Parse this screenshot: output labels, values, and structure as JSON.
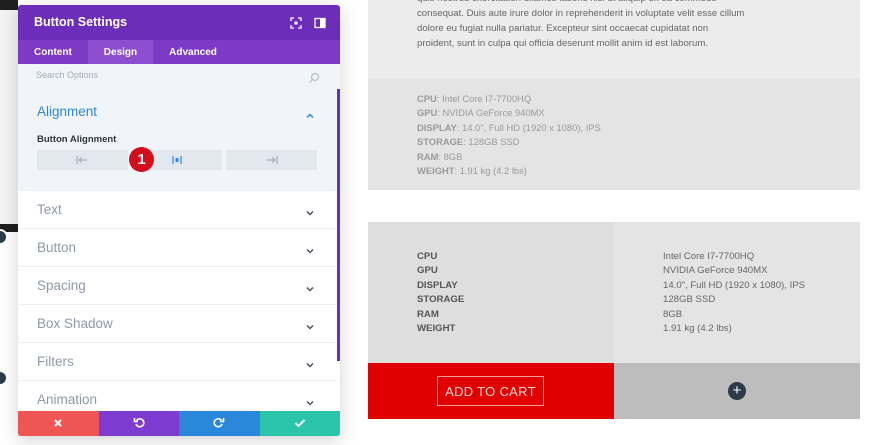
{
  "background_page": {
    "lorem_text": "quis nostrud exercitation ullamco laboris nisi ut aliquip ex ea commodo consequat. Duis aute irure dolor in reprehenderit in voluptate velit esse cillum dolore eu fugiat nulla pariatur. Excepteur sint occaecat cupidatat non proident, sunt in culpa qui officia deserunt mollit anim id est laborum.",
    "spec_list": [
      {
        "label": "CPU",
        "value": ": Intel Core I7-7700HQ"
      },
      {
        "label": "GPU",
        "value": ": NVIDIA GeForce 940MX"
      },
      {
        "label": "DISPLAY",
        "value": ": 14.0\", Full HD (1920 x 1080), IPS"
      },
      {
        "label": "STORAGE",
        "value": ": 128GB SSD"
      },
      {
        "label": "RAM",
        "value": ": 8GB"
      },
      {
        "label": "WEIGHT",
        "value": ": 1.91 kg (4.2 lbs)"
      }
    ],
    "spec_table": {
      "labels": [
        "CPU",
        "GPU",
        "DISPLAY",
        "STORAGE",
        "RAM",
        "WEIGHT"
      ],
      "values": [
        "Intel Core I7-7700HQ",
        "NVIDIA GeForce 940MX",
        "14.0\", Full HD (1920 x 1080), IPS",
        "128GB SSD",
        "8GB",
        "1.91 kg (4.2 lbs)"
      ]
    },
    "add_to_cart_label": "ADD TO CART",
    "add_module_symbol": "+"
  },
  "modal": {
    "title": "Button Settings",
    "header_icons": [
      "focus-mode-icon",
      "sidebar-toggle-icon"
    ],
    "tabs": [
      {
        "label": "Content",
        "active": false
      },
      {
        "label": "Design",
        "active": true
      },
      {
        "label": "Advanced",
        "active": false
      }
    ],
    "search_placeholder": "Search Options",
    "open_section": {
      "title": "Alignment",
      "field_label": "Button Alignment",
      "options": [
        "align-left-icon",
        "align-center-icon",
        "align-right-icon"
      ],
      "selected": "align-center-icon",
      "step_badge": "1"
    },
    "sections": [
      "Text",
      "Button",
      "Spacing",
      "Box Shadow",
      "Filters",
      "Animation"
    ],
    "footer_buttons": [
      "discard-icon",
      "undo-icon",
      "redo-icon",
      "save-icon"
    ]
  },
  "colors": {
    "header_purple": "#6c2eb9",
    "tab_purple": "#7d3ac5",
    "accent_blue": "#2b87da",
    "cart_red": "#e00000",
    "badge_red": "#d40d1c",
    "discard_red": "#ef5555",
    "save_green": "#29c4a9"
  }
}
